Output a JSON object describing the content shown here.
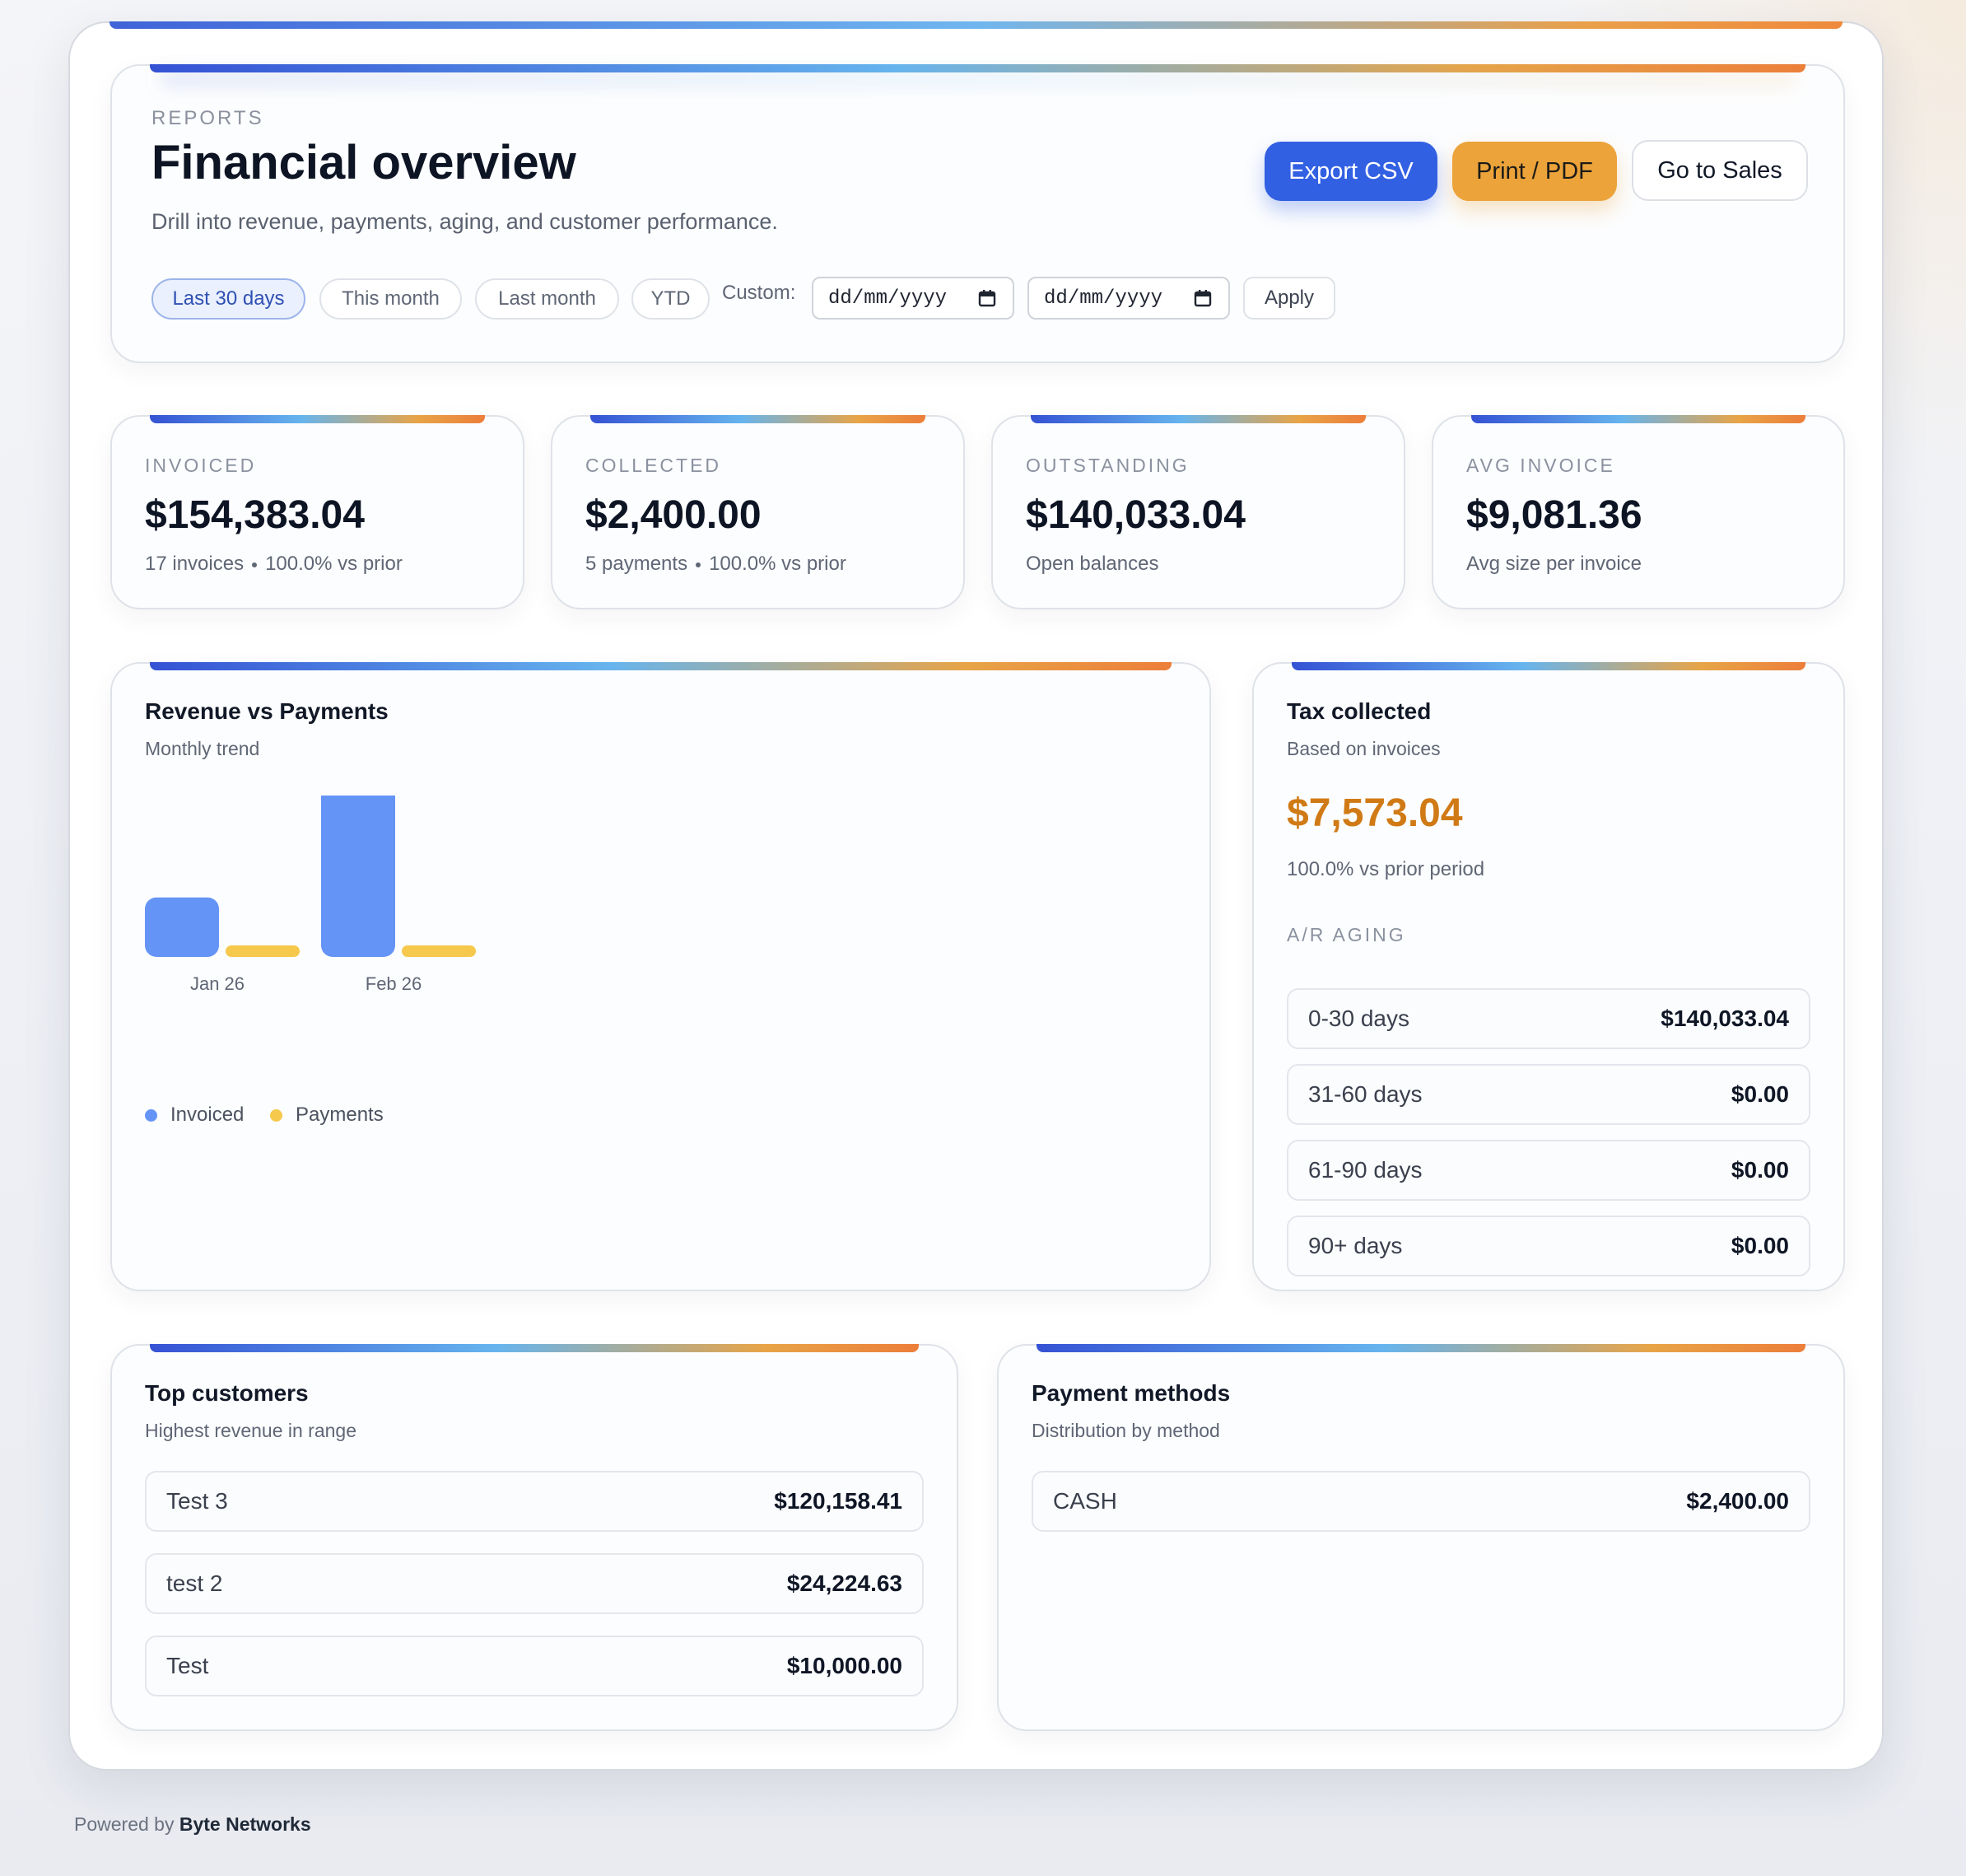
{
  "header": {
    "eyebrow": "REPORTS",
    "title": "Financial overview",
    "subtitle": "Drill into revenue, payments, aging, and customer performance.",
    "buttons": {
      "export": "Export CSV",
      "print": "Print / PDF",
      "sales": "Go to Sales"
    },
    "ranges": [
      "Last 30 days",
      "This month",
      "Last month",
      "YTD"
    ],
    "active_range": "Last 30 days",
    "custom_label": "Custom:",
    "date_from_placeholder": "dd/mm/yyyy",
    "date_to_placeholder": "dd/mm/yyyy",
    "apply_label": "Apply"
  },
  "kpis": [
    {
      "label": "INVOICED",
      "value": "$154,383.04",
      "meta_a": "17 invoices",
      "meta_b": "100.0% vs prior"
    },
    {
      "label": "COLLECTED",
      "value": "$2,400.00",
      "meta_a": "5 payments",
      "meta_b": "100.0% vs prior"
    },
    {
      "label": "OUTSTANDING",
      "value": "$140,033.04",
      "meta_a": "Open balances"
    },
    {
      "label": "AVG INVOICE",
      "value": "$9,081.36",
      "meta_a": "Avg size per invoice"
    }
  ],
  "revenue_panel": {
    "title": "Revenue vs Payments",
    "subtitle": "Monthly trend"
  },
  "chart_data": {
    "type": "bar",
    "categories": [
      "Jan 26",
      "Feb 26"
    ],
    "series": [
      {
        "name": "Invoiced",
        "values": [
          34000,
          120383.04
        ],
        "color": "#6594f7"
      },
      {
        "name": "Payments",
        "values": [
          1000,
          1400
        ],
        "color": "#f6c84c"
      }
    ],
    "ylim": [
      0,
      120383.04
    ],
    "grid": false,
    "legend": "bottom-left"
  },
  "tax_panel": {
    "title": "Tax collected",
    "subtitle": "Based on invoices",
    "value": "$7,573.04",
    "value_color": "#d07a16",
    "meta": "100.0% vs prior period",
    "aging_label": "A/R AGING",
    "aging": [
      {
        "k": "0-30 days",
        "v": "$140,033.04"
      },
      {
        "k": "31-60 days",
        "v": "$0.00"
      },
      {
        "k": "61-90 days",
        "v": "$0.00"
      },
      {
        "k": "90+ days",
        "v": "$0.00"
      }
    ]
  },
  "customers_panel": {
    "title": "Top customers",
    "subtitle": "Highest revenue in range",
    "rows": [
      {
        "k": "Test 3",
        "v": "$120,158.41"
      },
      {
        "k": "test 2",
        "v": "$24,224.63"
      },
      {
        "k": "Test",
        "v": "$10,000.00"
      }
    ]
  },
  "methods_panel": {
    "title": "Payment methods",
    "subtitle": "Distribution by method",
    "rows": [
      {
        "k": "CASH",
        "v": "$2,400.00"
      }
    ]
  },
  "footer": {
    "prefix": "Powered by",
    "brand": "Byte Networks"
  }
}
